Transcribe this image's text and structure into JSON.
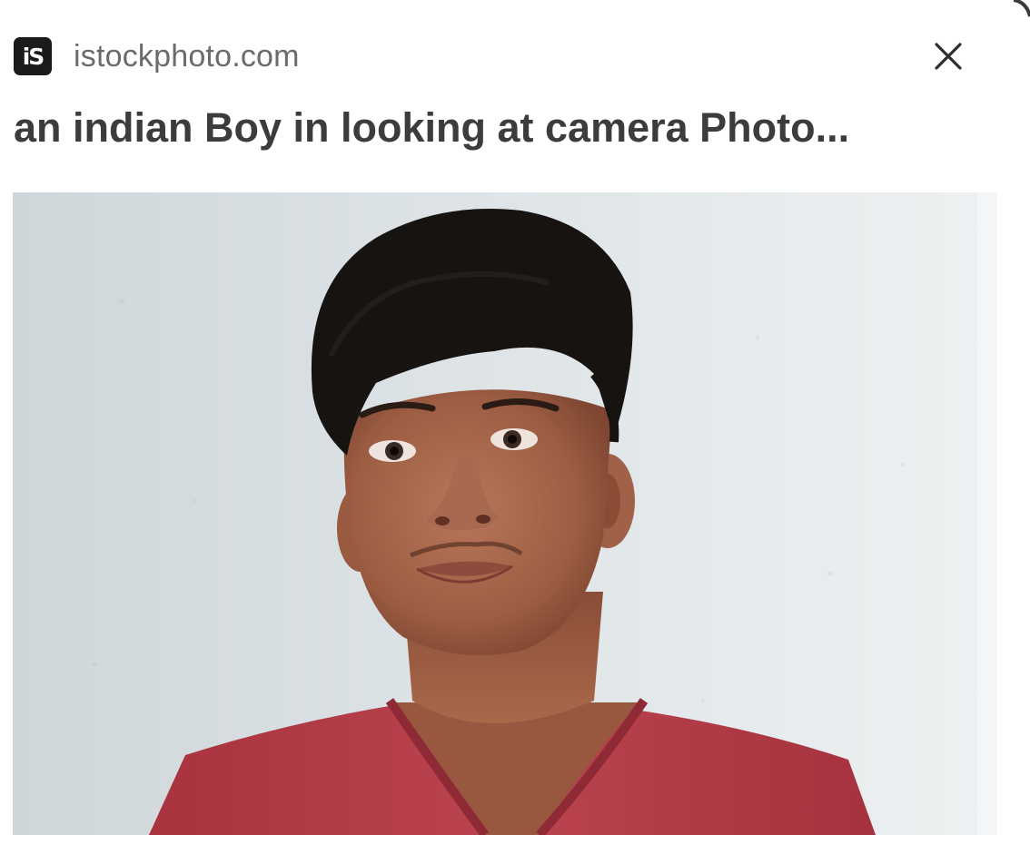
{
  "source": {
    "site_name": "istockphoto.com",
    "logo_text": "iS"
  },
  "result": {
    "title": "an indian Boy in looking at camera Photo..."
  },
  "icons": {
    "close": "close-icon",
    "logo": "istock-logo-icon"
  },
  "colors": {
    "title_text": "#3c3c3c",
    "site_text": "#6b6b6b",
    "logo_bg": "#1b1b1b",
    "wall": "#d8dfe2",
    "shirt": "#b23c48",
    "hair": "#141211",
    "skin": "#a8674a"
  }
}
